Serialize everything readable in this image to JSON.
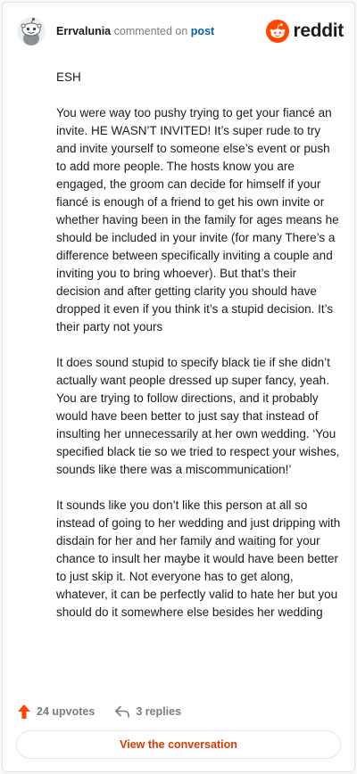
{
  "header": {
    "username": "Errvalunia",
    "verb": "commented on",
    "post_link": "post",
    "brand": "reddit",
    "brand_color": "#ff4500",
    "avatar_icon": "snoo-avatar-icon",
    "logo_icon": "reddit-snoo-logo-icon"
  },
  "comment": {
    "paragraphs": [
      "ESH",
      "You were way too pushy trying to get your fiancé an invite. HE WASN’T INVITED! It’s super rude to try and invite yourself to someone else’s event or push to add more people. The hosts know you are engaged, the groom can decide for himself if your fiancé is enough of a friend to get his own invite or whether having been in the family for ages means he should be included in your invite (for many There’s a difference between specifically inviting a couple and inviting you to bring whoever). But that’s their decision and after getting clarity you should have dropped it even if you think it’s a stupid decision. It’s their party not yours",
      "It does sound stupid to specify black tie if she didn’t actually want people dressed up super fancy, yeah. You are trying to follow directions, and it probably would have been better to just say that instead of insulting her unnecessarily at her own wedding. ‘You specified black tie so we tried to respect your wishes, sounds like there was a miscommunication!’",
      "It sounds like you don’t like this person at all so instead of going to her wedding and just dripping with disdain for her and her family and waiting for your chance to insult her maybe it would have been better to just skip it. Not everyone has to get along, whatever, it can be perfectly valid to hate her but you should do it somewhere else besides her wedding"
    ]
  },
  "footer": {
    "upvotes": "24 upvotes",
    "replies": "3 replies",
    "upvote_icon": "upvote-arrow-icon",
    "reply_icon": "reply-arrow-icon",
    "upvote_color": "#ff4500"
  },
  "cta": {
    "label": "View the conversation",
    "color": "#d93a00"
  }
}
